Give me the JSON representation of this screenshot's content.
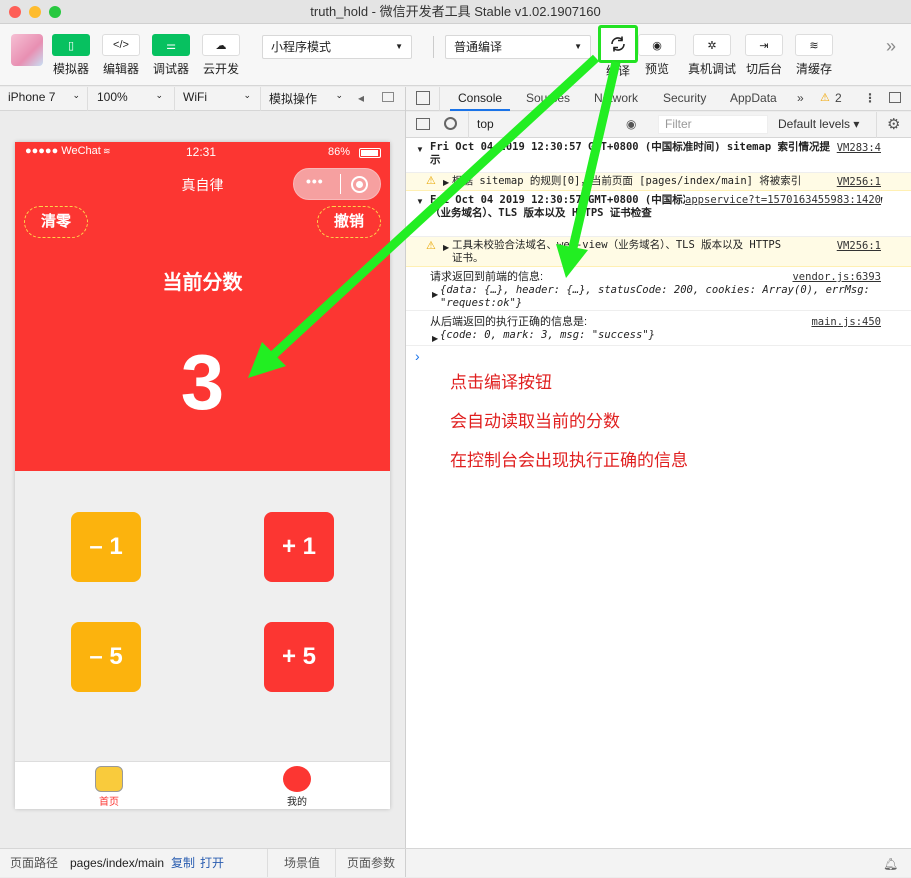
{
  "window": {
    "title": "truth_hold - 微信开发者工具 Stable v1.02.1907160"
  },
  "toolbar": {
    "simulator": "模拟器",
    "editor": "编辑器",
    "debugger": "调试器",
    "cloud": "云开发",
    "mode_select": "小程序模式",
    "compile_select": "普通编译",
    "compile": "编译",
    "preview": "预览",
    "remote_debug": "真机调试",
    "background": "切后台",
    "clear_cache": "清缓存",
    "more": "»"
  },
  "sim_bar": {
    "device": "iPhone 7",
    "zoom": "100%",
    "network": "WiFi",
    "ops": "模拟操作"
  },
  "devtools": {
    "tabs": [
      "Console",
      "Sources",
      "Network",
      "Security",
      "AppData"
    ],
    "more": "»",
    "warn_count": "2",
    "context": "top",
    "filter_placeholder": "Filter",
    "levels": "Default levels ▾"
  },
  "phone": {
    "carrier": "●●●●● WeChat",
    "time": "12:31",
    "battery": "86%",
    "nav_title": "真自律",
    "clear_btn": "清零",
    "undo_btn": "撤销",
    "score_label": "当前分数",
    "score": "3",
    "buttons": {
      "minus1": "– 1",
      "plus1": "+ 1",
      "minus5": "– 5",
      "plus5": "+ 5"
    },
    "tabs": {
      "home": "首页",
      "mine": "我的"
    }
  },
  "console": [
    {
      "text": "Fri Oct 04 2019 12:30:57 GMT+0800 (中国标准时间) sitemap 索引情况提示",
      "source": "VM283:4"
    },
    {
      "text": "根据 sitemap 的规则[0]，当前页面 [pages/index/main] 将被索引",
      "source": "VM256:1"
    },
    {
      "text": "Fri Oct 04 2019 12:30:57 GMT+0800 (中国标准时间) 配置中关闭合法域名、web-view（业务域名）、TLS 版本以及 HTTPS 证书检查",
      "source": "appservice?t=1570163455983:1420"
    },
    {
      "text": "工具未校验合法域名、web-view（业务域名）、TLS 版本以及 HTTPS 证书。",
      "source": "VM256:1"
    },
    {
      "text": "请求返回到前端的信息:",
      "obj": "{data: {…}, header: {…}, statusCode: 200, cookies: Array(0), errMsg: \"request:ok\"}",
      "source": "vendor.js:6393"
    },
    {
      "text": "从后端返回的执行正确的信息是:",
      "obj": "{code: 0, mark: 3, msg: \"success\"}",
      "source": "main.js:450"
    }
  ],
  "prompt": "›",
  "annotations": [
    "点击编译按钮",
    "会自动读取当前的分数",
    "在控制台会出现执行正确的信息"
  ],
  "bottom": {
    "path_label": "页面路径",
    "path": "pages/index/main",
    "copy": "复制",
    "open": "打开",
    "scene": "场景值",
    "params": "页面参数"
  }
}
